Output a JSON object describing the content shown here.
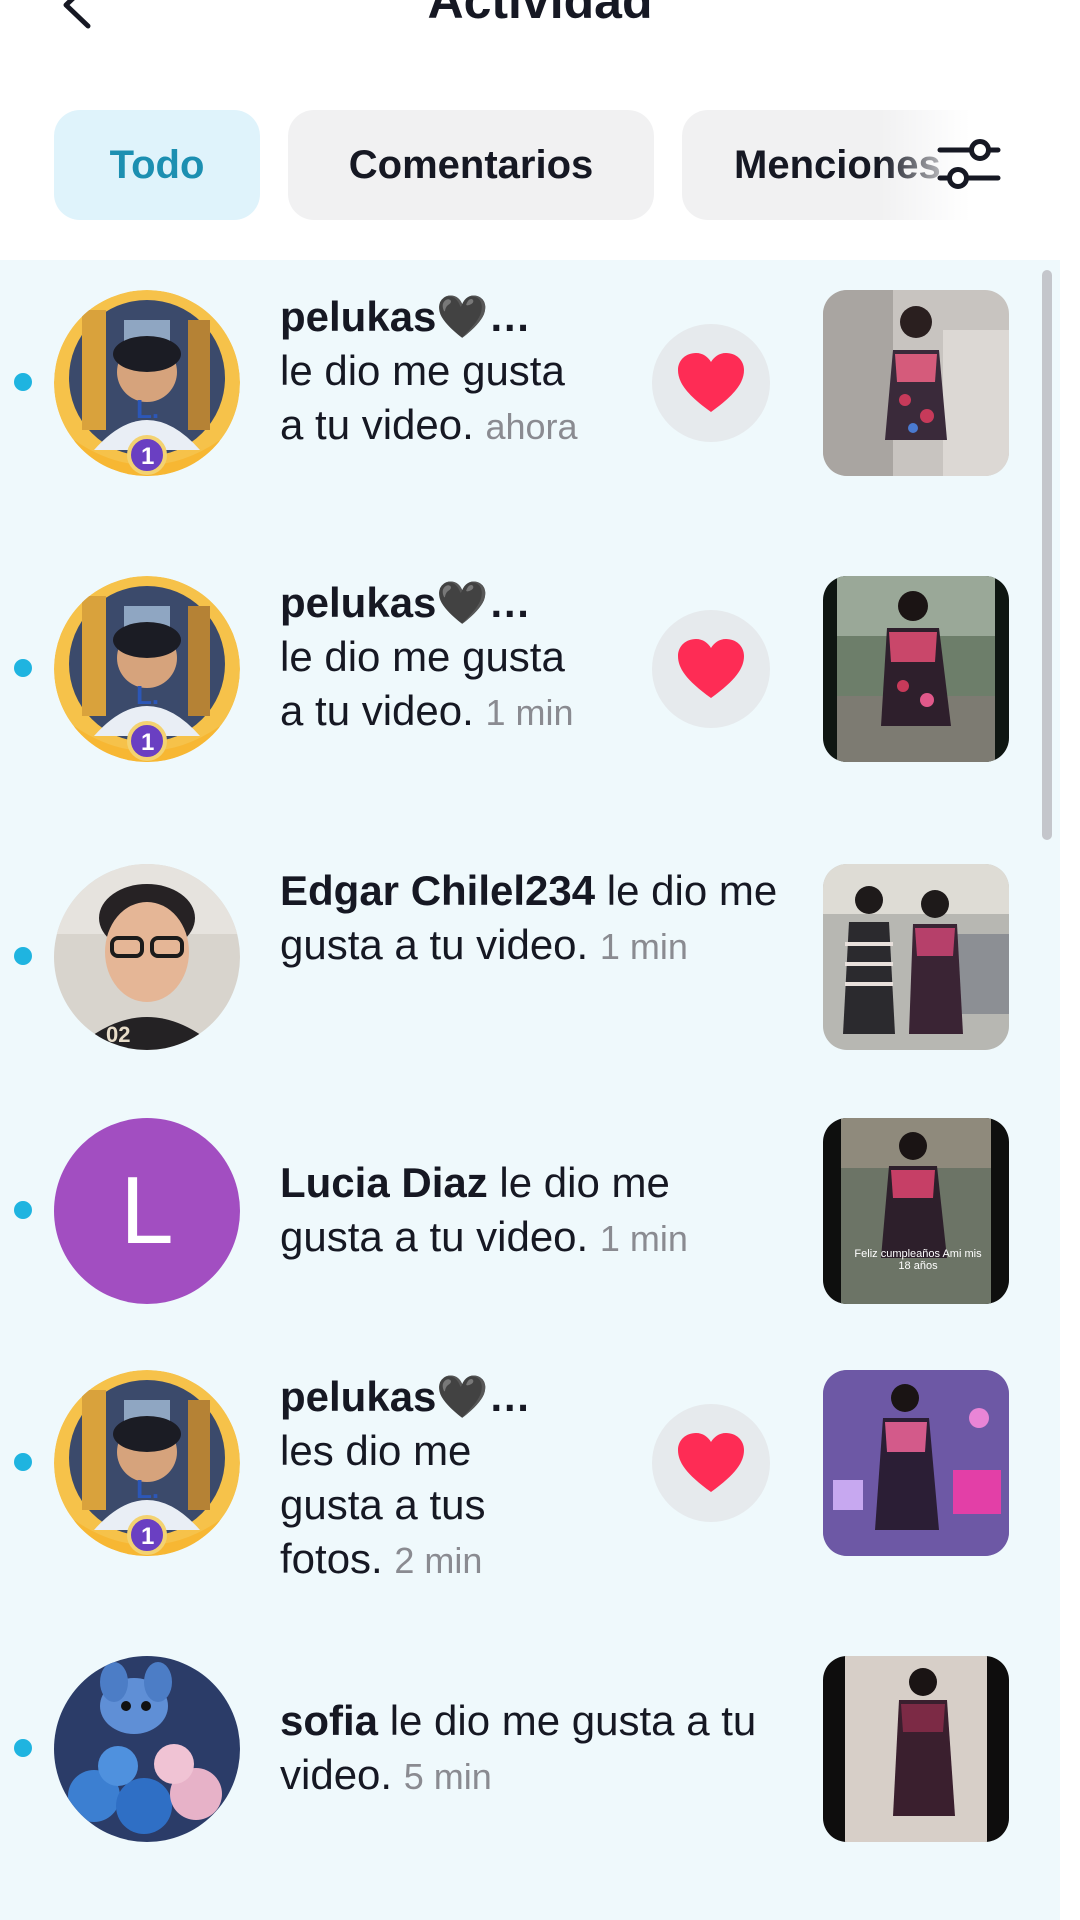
{
  "header": {
    "title": "Actividad"
  },
  "tabs": [
    {
      "label": "Todo",
      "active": true
    },
    {
      "label": "Comentarios",
      "active": false
    },
    {
      "label": "Menciones",
      "active": false
    }
  ],
  "notifications": [
    {
      "name": "pelukas🖤…",
      "action": "le dio me gusta a tu video.",
      "time": "ahora",
      "liked": true,
      "avatar": "trophy-avatar"
    },
    {
      "name": "pelukas🖤…",
      "action": "le dio me gusta a tu video.",
      "time": "1 min",
      "liked": true,
      "avatar": "trophy-avatar"
    },
    {
      "name": "Edgar Chilel234",
      "action": "le dio me gusta a tu video.",
      "time": "1 min",
      "liked": false,
      "avatar": "photo-avatar"
    },
    {
      "name": "Lucia Diaz",
      "action": "le dio me gusta a tu video.",
      "time": "1 min",
      "liked": false,
      "avatar": "letter-avatar",
      "initial": "L"
    },
    {
      "name": "pelukas🖤…",
      "action": "les dio me gusta a tus fotos.",
      "time": "2 min",
      "liked": true,
      "avatar": "trophy-avatar"
    },
    {
      "name": "sofia",
      "action": "le dio me gusta a tu video.",
      "time": "5 min",
      "liked": false,
      "avatar": "stitch-avatar"
    }
  ],
  "thumbnail_caption": "Feliz cumpleaños Ami mis 18 años",
  "colors": {
    "accent": "#1fb4e0",
    "active_tab_bg": "#dff3fb",
    "active_tab_text": "#1c8fb1",
    "heart": "#fe2c55",
    "list_bg": "#eff9fc",
    "letter_avatar_bg": "#a24ec1"
  },
  "icons": {
    "back": "chevron-left-icon",
    "filter": "sliders-icon",
    "like": "heart-icon"
  }
}
